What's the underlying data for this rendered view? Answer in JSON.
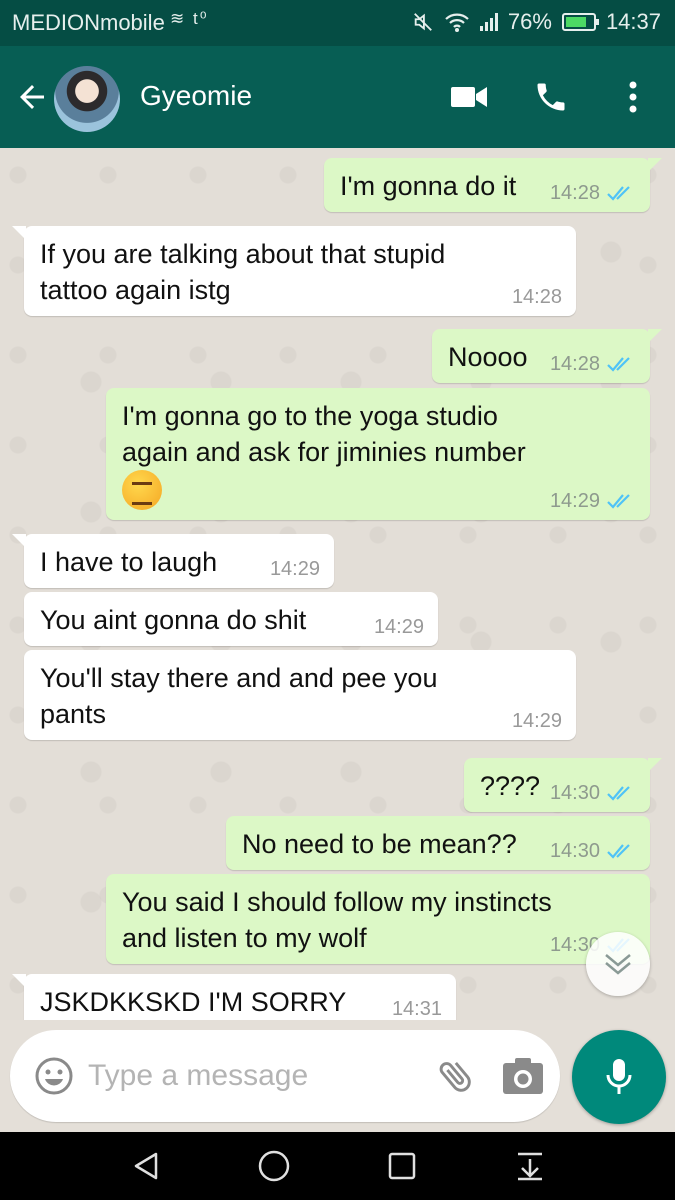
{
  "status_bar": {
    "carrier": "MEDIONmobile",
    "carrier_icons": "≋ t⁰",
    "battery_percent": "76%",
    "battery_level": 0.76,
    "time": "14:37"
  },
  "header": {
    "contact_name": "Gyeomie",
    "icons": [
      "back-arrow-icon",
      "video-call-icon",
      "phone-icon",
      "more-options-icon"
    ]
  },
  "messages": [
    {
      "dir": "out",
      "lines": [
        "I'm gonna do it"
      ],
      "time": "14:28",
      "read": true
    },
    {
      "dir": "in",
      "lines": [
        "If you are talking about that stupid",
        "tattoo again istg"
      ],
      "time": "14:28"
    },
    {
      "dir": "out",
      "lines": [
        "Noooo"
      ],
      "time": "14:28",
      "read": true
    },
    {
      "dir": "out",
      "lines": [
        "I'm gonna go to the yoga studio",
        "again and ask for jiminies number"
      ],
      "emoji": "confounded-face",
      "time": "14:29",
      "read": true
    },
    {
      "dir": "in",
      "lines": [
        "I have to laugh"
      ],
      "time": "14:29"
    },
    {
      "dir": "in",
      "lines": [
        "You aint gonna do shit"
      ],
      "time": "14:29"
    },
    {
      "dir": "in",
      "lines": [
        "You'll stay there and and pee you",
        "pants"
      ],
      "time": "14:29"
    },
    {
      "dir": "out",
      "lines": [
        "????"
      ],
      "time": "14:30",
      "read": true
    },
    {
      "dir": "out",
      "lines": [
        "No need to be mean??"
      ],
      "time": "14:30",
      "read": true
    },
    {
      "dir": "out",
      "lines": [
        "You said I should follow my instincts",
        "and listen to my wolf"
      ],
      "time": "14:30",
      "read": true
    },
    {
      "dir": "in",
      "lines": [
        "JSKDKKSKD I'M SORRY"
      ],
      "time": "14:31"
    }
  ],
  "composer": {
    "placeholder": "Type a message",
    "icons": [
      "emoji-icon",
      "attachment-icon",
      "camera-icon",
      "microphone-icon"
    ]
  },
  "nav": {
    "icons": [
      "back-triangle-icon",
      "home-circle-icon",
      "recents-square-icon",
      "notifications-pull-icon"
    ]
  },
  "colors": {
    "header": "#075e54",
    "status_bar": "#054d44",
    "outgoing_bubble": "#dcf8c6",
    "incoming_bubble": "#ffffff",
    "read_ticks": "#4fc3f7",
    "mic_button": "#00897b"
  }
}
